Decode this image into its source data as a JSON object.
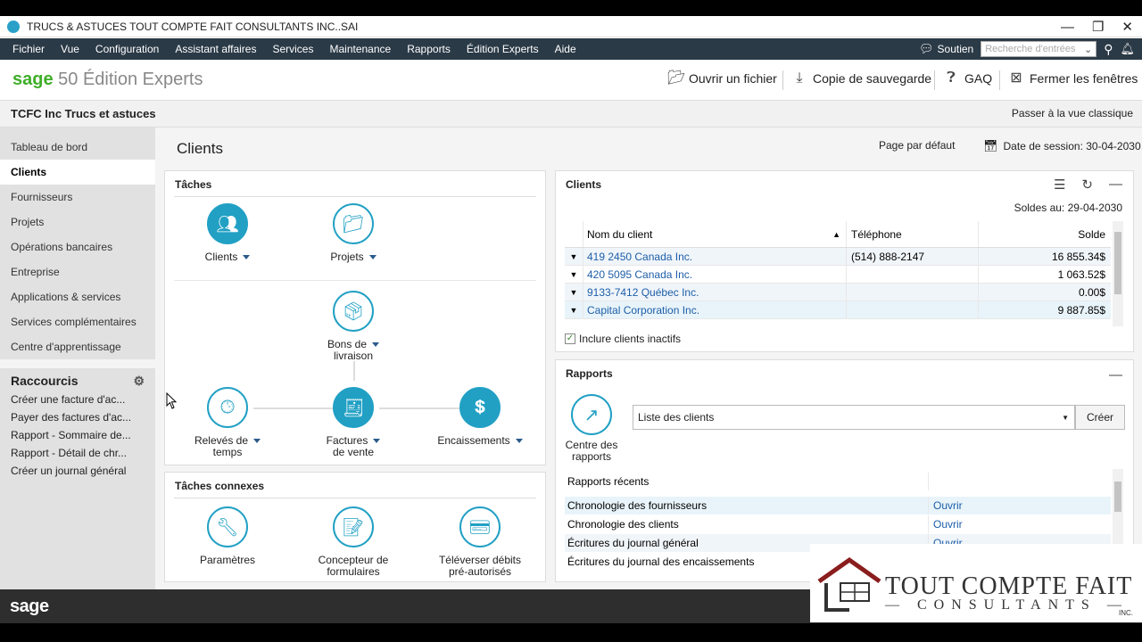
{
  "window": {
    "title": "TRUCS & ASTUCES TOUT COMPTE FAIT CONSULTANTS INC..SAI",
    "controls": [
      "—",
      "❐",
      "✕"
    ]
  },
  "menu": {
    "items": [
      "Fichier",
      "Vue",
      "Configuration",
      "Assistant affaires",
      "Services",
      "Maintenance",
      "Rapports",
      "Édition Experts",
      "Aide"
    ],
    "support": "Soutien",
    "search_placeholder": "Recherche d'entrées"
  },
  "brand": {
    "sage": "sage",
    "product": " 50 Édition Experts"
  },
  "toolbar": {
    "open_file": "Ouvrir un fichier",
    "backup": "Copie de sauvegarde",
    "faq": "GAQ",
    "close_windows": "Fermer les fenêtres"
  },
  "company": {
    "name": "TCFC Inc Trucs et astuces",
    "classic_view": "Passer à la vue classique"
  },
  "sidebar": {
    "items": [
      "Tableau de bord",
      "Clients",
      "Fournisseurs",
      "Projets",
      "Opérations bancaires",
      "Entreprise",
      "Applications & services",
      "Services complémentaires",
      "Centre d'apprentissage"
    ],
    "active_index": 1,
    "shortcuts_title": "Raccourcis",
    "shortcuts": [
      "Créer une  facture d'ac...",
      "Payer des factures d'ac...",
      "Rapport - Sommaire de...",
      "Rapport - Détail de chr...",
      "Créer un journal général"
    ]
  },
  "main": {
    "title": "Clients",
    "default_page": "Page par défaut",
    "session": "Date de session: 30-04-2030"
  },
  "tasks": {
    "title": "Tâches",
    "clients": "Clients",
    "projects": "Projets",
    "delivery_line1": "Bons de",
    "delivery_line2": "livraison",
    "timesheets_line1": "Relevés de",
    "timesheets_line2": "temps",
    "invoices_line1": "Factures",
    "invoices_line2": "de vente",
    "receipts": "Encaissements"
  },
  "related_tasks": {
    "title": "Tâches connexes",
    "settings": "Paramètres",
    "forms_line1": "Concepteur de",
    "forms_line2": "formulaires",
    "upload_line1": "Téléverser débits",
    "upload_line2": "pré-autorisés"
  },
  "clients_panel": {
    "title": "Clients",
    "balance_date": "Soldes au: 29-04-2030",
    "columns": {
      "name": "Nom du client",
      "phone": "Téléphone",
      "balance": "Solde"
    },
    "rows": [
      {
        "name": "419 2450 Canada Inc.",
        "phone": "(514) 888-2147",
        "balance": "16 855.34$"
      },
      {
        "name": "420 5095 Canada Inc.",
        "phone": "",
        "balance": "1 063.52$"
      },
      {
        "name": "9133-7412 Québec Inc.",
        "phone": "",
        "balance": "0.00$"
      },
      {
        "name": "Capital Corporation Inc.",
        "phone": "",
        "balance": "9 887.85$"
      }
    ],
    "include_inactive": "Inclure clients inactifs"
  },
  "reports_panel": {
    "title": "Rapports",
    "center_line1": "Centre des",
    "center_line2": "rapports",
    "selected_report": "Liste des clients",
    "create": "Créer",
    "recent_title": "Rapports récents",
    "recent": [
      {
        "name": "Chronologie des fournisseurs",
        "action": "Ouvrir"
      },
      {
        "name": "Chronologie des clients",
        "action": "Ouvrir"
      },
      {
        "name": "Écritures du journal général",
        "action": "Ouvrir"
      },
      {
        "name": "Écritures du journal des encaissements",
        "action": ""
      }
    ]
  },
  "footer": {
    "logo": "sage"
  },
  "watermark": {
    "line1": "TOUT COMPTE FAIT",
    "line2": "— CONSULTANTS —",
    "inc": "INC."
  }
}
